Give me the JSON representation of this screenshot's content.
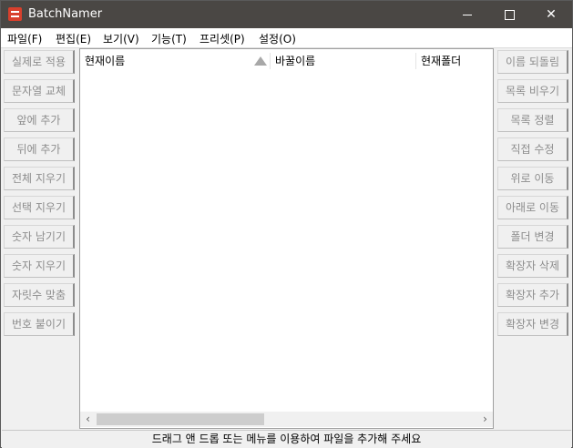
{
  "window": {
    "title": "BatchNamer",
    "controls": {
      "minimize": "minimize",
      "maximize": "maximize",
      "close": "✕"
    }
  },
  "menu": [
    "파일(F)",
    "편집(E)",
    "보기(V)",
    "기능(T)",
    "프리셋(P)",
    "설정(O)"
  ],
  "left_buttons": [
    "실제로 적용",
    "문자열 교체",
    "앞에 추가",
    "뒤에 추가",
    "전체 지우기",
    "선택 지우기",
    "숫자 남기기",
    "숫자 지우기",
    "자릿수 맞춤",
    "번호 붙이기"
  ],
  "right_buttons": [
    "이름 되돌림",
    "목록 비우기",
    "목록 정렬",
    "직접 수정",
    "위로 이동",
    "아래로 이동",
    "폴더 변경",
    "확장자 삭제",
    "확장자 추가",
    "확장자 변경"
  ],
  "columns": [
    "현재이름",
    "바꿀이름",
    "현재폴더"
  ],
  "scrollbar": {
    "left_arrow": "‹",
    "right_arrow": "›"
  },
  "status": "드래그 앤 드롭 또는 메뉴를 이용하여 파일을 추가해 주세요",
  "colors": {
    "titlebar": "#4a4744",
    "disabled_text": "#8d8d8d",
    "accent": "#d8402d"
  }
}
